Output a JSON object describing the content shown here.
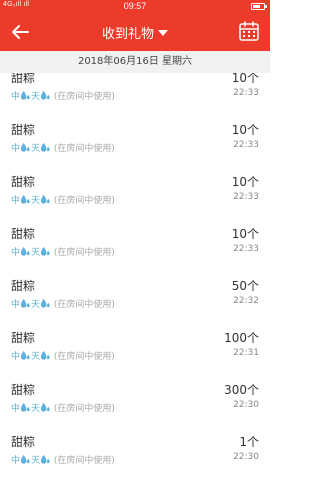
{
  "status": {
    "left_text": "4G₂ıll ıll",
    "time": "09:57",
    "battery_level": 0.7
  },
  "header": {
    "title": "收到礼物"
  },
  "date_label": "2018年06月16日 星期六",
  "gifts": [
    {
      "name": "甜粽",
      "sender_a": "中",
      "sender_b": "天",
      "location": "(在房间中使用)",
      "count": "10个",
      "time": "22:33"
    },
    {
      "name": "甜粽",
      "sender_a": "中",
      "sender_b": "天",
      "location": "(在房间中使用)",
      "count": "10个",
      "time": "22:33"
    },
    {
      "name": "甜粽",
      "sender_a": "中",
      "sender_b": "天",
      "location": "(在房间中使用)",
      "count": "10个",
      "time": "22:33"
    },
    {
      "name": "甜粽",
      "sender_a": "中",
      "sender_b": "天",
      "location": "(在房间中使用)",
      "count": "10个",
      "time": "22:33"
    },
    {
      "name": "甜粽",
      "sender_a": "中",
      "sender_b": "天",
      "location": "(在房间中使用)",
      "count": "50个",
      "time": "22:32"
    },
    {
      "name": "甜粽",
      "sender_a": "中",
      "sender_b": "天",
      "location": "(在房间中使用)",
      "count": "100个",
      "time": "22:31"
    },
    {
      "name": "甜粽",
      "sender_a": "中",
      "sender_b": "天",
      "location": "(在房间中使用)",
      "count": "300个",
      "time": "22:30"
    },
    {
      "name": "甜粽",
      "sender_a": "中",
      "sender_b": "天",
      "location": "(在房间中使用)",
      "count": "1个",
      "time": "22:30"
    }
  ],
  "colors": {
    "header_bg": "#ec3a2b",
    "sender": "#58b2d8"
  },
  "icons": {
    "back": "arrow-left-icon",
    "calendar": "calendar-icon",
    "dropdown": "caret-down-icon",
    "sender_emoji": "sweat-drops-icon"
  }
}
